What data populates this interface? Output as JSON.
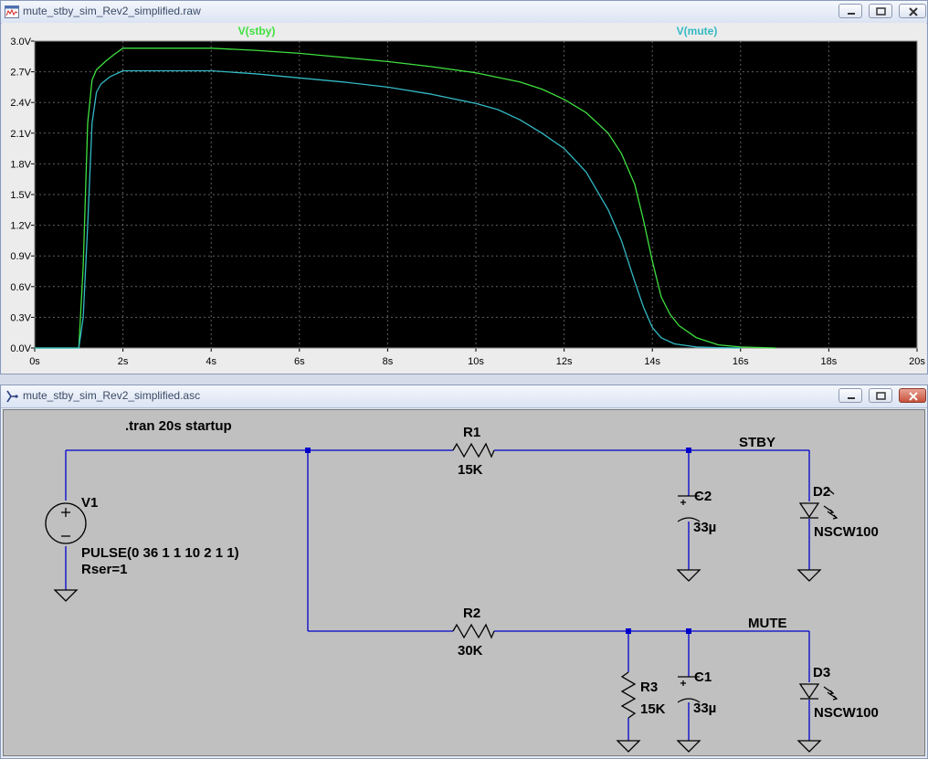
{
  "plot_window": {
    "title": "mute_stby_sim_Rev2_simplified.raw",
    "trace_labels": [
      "V(stby)",
      "V(mute)"
    ]
  },
  "schematic_window": {
    "title": "mute_stby_sim_Rev2_simplified.asc",
    "directive": ".tran 20s startup",
    "v1": {
      "name": "V1",
      "value": "PULSE(0 36 1 1 10 2 1 1)",
      "rser": "Rser=1"
    },
    "r1": {
      "name": "R1",
      "value": "15K"
    },
    "r2": {
      "name": "R2",
      "value": "30K"
    },
    "r3": {
      "name": "R3",
      "value": "15K"
    },
    "c1": {
      "name": "C1",
      "value": "33µ"
    },
    "c2": {
      "name": "C2",
      "value": "33µ"
    },
    "d2": {
      "name": "D2",
      "value": "NSCW100"
    },
    "d3": {
      "name": "D3",
      "value": "NSCW100"
    },
    "net_stby": "STBY",
    "net_mute": "MUTE"
  },
  "colors": {
    "stby": "#3fe03f",
    "mute": "#33b9c4",
    "wire": "#0000cc",
    "background": "#000000",
    "grid": "#606060"
  },
  "chart_data": {
    "type": "line",
    "x_unit": "s",
    "y_unit": "V",
    "xlim": [
      0,
      20
    ],
    "ylim": [
      0,
      3.0
    ],
    "x_ticks": [
      "0s",
      "2s",
      "4s",
      "6s",
      "8s",
      "10s",
      "12s",
      "14s",
      "16s",
      "18s",
      "20s"
    ],
    "y_ticks": [
      "3.0V",
      "2.7V",
      "2.4V",
      "2.1V",
      "1.8V",
      "1.5V",
      "1.2V",
      "0.9V",
      "0.6V",
      "0.3V",
      "0.0V"
    ],
    "grid": true,
    "series": [
      {
        "name": "V(stby)",
        "color": "#3fe03f",
        "x": [
          0,
          1.0,
          1.1,
          1.2,
          1.3,
          1.4,
          1.6,
          1.8,
          2.0,
          3.0,
          4.0,
          5.0,
          6.0,
          7.0,
          8.0,
          9.0,
          10.0,
          11.0,
          11.5,
          12.0,
          12.5,
          13.0,
          13.3,
          13.6,
          13.8,
          14.0,
          14.2,
          14.4,
          14.6,
          15.0,
          15.5,
          16.0,
          16.8
        ],
        "y": [
          0,
          0,
          0.8,
          2.2,
          2.62,
          2.72,
          2.8,
          2.87,
          2.93,
          2.93,
          2.93,
          2.91,
          2.88,
          2.84,
          2.8,
          2.75,
          2.69,
          2.6,
          2.53,
          2.43,
          2.3,
          2.1,
          1.9,
          1.6,
          1.25,
          0.85,
          0.5,
          0.33,
          0.22,
          0.1,
          0.03,
          0.01,
          0
        ]
      },
      {
        "name": "V(mute)",
        "color": "#33b9c4",
        "x": [
          0,
          1.0,
          1.1,
          1.2,
          1.3,
          1.4,
          1.5,
          1.7,
          2.0,
          3.0,
          4.0,
          5.0,
          6.0,
          7.0,
          8.0,
          9.0,
          10.0,
          10.5,
          11.0,
          11.5,
          12.0,
          12.5,
          13.0,
          13.3,
          13.6,
          13.8,
          14.0,
          14.2,
          14.5,
          15.0,
          15.5,
          16.0
        ],
        "y": [
          0,
          0,
          0.3,
          1.2,
          2.2,
          2.5,
          2.58,
          2.65,
          2.71,
          2.71,
          2.71,
          2.68,
          2.64,
          2.6,
          2.55,
          2.48,
          2.39,
          2.33,
          2.23,
          2.1,
          1.95,
          1.72,
          1.35,
          1.05,
          0.65,
          0.4,
          0.2,
          0.1,
          0.04,
          0.01,
          0.003,
          0
        ]
      }
    ]
  }
}
